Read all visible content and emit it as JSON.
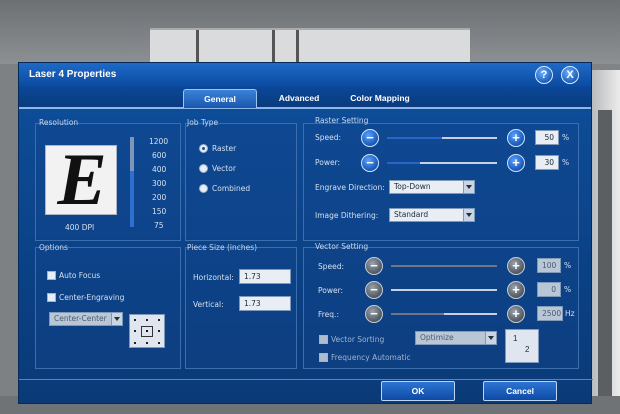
{
  "window": {
    "title": "Laser 4 Properties",
    "help_icon": "?",
    "close_icon": "X"
  },
  "tabs": [
    {
      "label": "General",
      "active": true
    },
    {
      "label": "Advanced",
      "active": false
    },
    {
      "label": "Color Mapping",
      "active": false
    }
  ],
  "resolution": {
    "label": "Resolution",
    "preview_letter": "E",
    "dpi_label": "400 DPI",
    "scale": [
      "1200",
      "600",
      "400",
      "300",
      "200",
      "150",
      "75"
    ],
    "level": 0.62
  },
  "job_type": {
    "label": "Job Type",
    "options": [
      {
        "label": "Raster",
        "selected": true
      },
      {
        "label": "Vector",
        "selected": false
      },
      {
        "label": "Combined",
        "selected": false
      }
    ]
  },
  "raster": {
    "label": "Raster Setting",
    "speed_label": "Speed:",
    "speed_value": "50",
    "speed_unit": "%",
    "speed_level": 0.5,
    "power_label": "Power:",
    "power_value": "30",
    "power_unit": "%",
    "power_level": 0.3,
    "engrave_direction_label": "Engrave Direction:",
    "engrave_direction_value": "Top-Down",
    "image_dithering_label": "Image Dithering:",
    "image_dithering_value": "Standard"
  },
  "options": {
    "label": "Options",
    "auto_focus": "Auto Focus",
    "center_engraving": "Center-Engraving",
    "center_select": "Center-Center"
  },
  "piece_size": {
    "label": "Piece Size (inches)",
    "horizontal_label": "Horizontal:",
    "horizontal_value": "1.73",
    "vertical_label": "Vertical:",
    "vertical_value": "1.73"
  },
  "vector": {
    "label": "Vector Setting",
    "speed_label": "Speed:",
    "speed_value": "100",
    "speed_unit": "%",
    "speed_level": 1.0,
    "power_label": "Power:",
    "power_value": "0",
    "power_unit": "%",
    "power_level": 0.0,
    "freq_label": "Freq.:",
    "freq_value": "2500",
    "freq_unit": "Hz",
    "freq_level": 0.5,
    "vector_sorting": "Vector Sorting",
    "vector_sorting_value": "Optimize",
    "frequency_automatic": "Frequency Automatic",
    "sort_icon_a": "1",
    "sort_icon_b": "2"
  },
  "buttons": {
    "minus": "−",
    "plus": "+",
    "ok": "OK",
    "cancel": "Cancel"
  },
  "colors": {
    "accent": "#1756b5",
    "dialog_bg": "#0a3f82"
  }
}
